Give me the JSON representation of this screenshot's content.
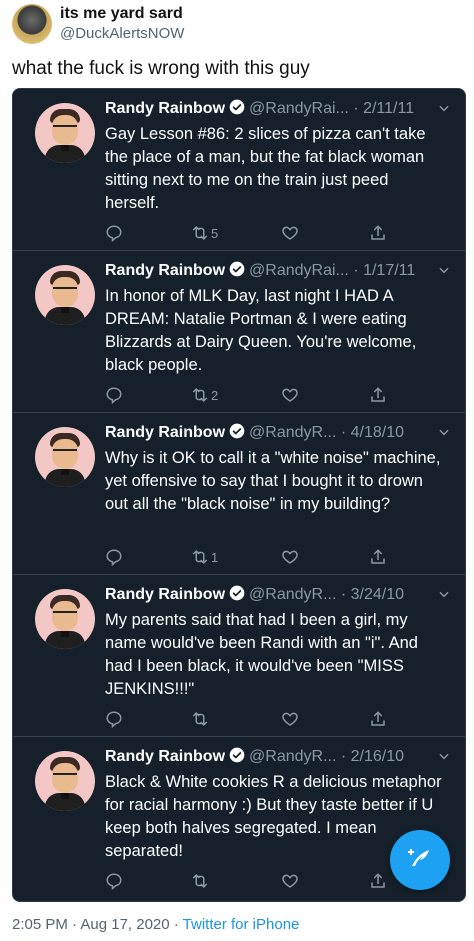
{
  "post": {
    "display_name": "its me yard sard",
    "handle": "@DuckAlertsNOW",
    "text": "what the fuck is wrong with this guy",
    "timestamp": "2:05 PM · Aug 17, 2020 · ",
    "source": "Twitter for iPhone"
  },
  "quoted_tweets": [
    {
      "name": "Randy Rainbow",
      "handle": "@RandyRai...",
      "date": "· 2/11/11",
      "text": "Gay Lesson #86: 2 slices of pizza can't take the place of a man, but the fat black woman sitting next to me on the train just peed herself.",
      "retweets": "5"
    },
    {
      "name": "Randy Rainbow",
      "handle": "@RandyRai...",
      "date": "· 1/17/11",
      "text": "In honor of MLK Day, last night I HAD A DREAM: Natalie Portman & I were eating Blizzards at Dairy Queen. You're welcome, black people.",
      "retweets": "2"
    },
    {
      "name": "Randy Rainbow",
      "handle": "@RandyR...",
      "date": "· 4/18/10",
      "text": "Why is it OK to call it a \"white noise\" machine, yet offensive to say that I bought it to drown out all the \"black noise\" in my building?",
      "retweets": "1"
    },
    {
      "name": "Randy Rainbow",
      "handle": "@RandyR...",
      "date": "· 3/24/10",
      "text": "My parents said that had I been a girl, my name would've been Randi with an \"i\". And had I been black, it would've been \"MISS JENKINS!!!\"",
      "retweets": ""
    },
    {
      "name": "Randy Rainbow",
      "handle": "@RandyR...",
      "date": "· 2/16/10",
      "text": "Black & White cookies R a delicious metaphor for racial harmony :) But they taste better if U keep both halves segregated. I mean separated!",
      "retweets": ""
    }
  ],
  "colors": {
    "card_bg": "#15202b",
    "accent": "#1da1f2",
    "muted": "#8899a6"
  },
  "icons": [
    "reply-icon",
    "retweet-icon",
    "like-icon",
    "share-icon",
    "verified-icon",
    "chevron-down-icon",
    "compose-icon"
  ]
}
